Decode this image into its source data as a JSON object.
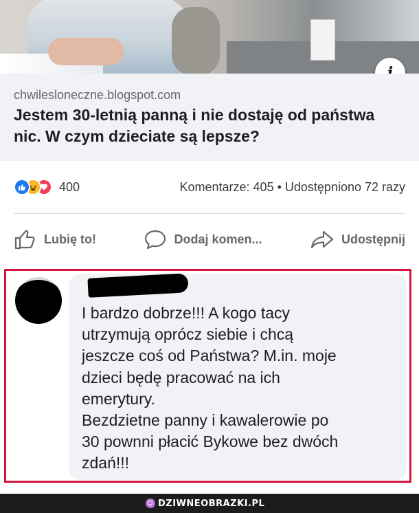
{
  "post": {
    "info_icon": "info-icon",
    "domain": "chwilesloneczne.blogspot.com",
    "headline": "Jestem 30-letnią panną i nie dostaję od państwa nic. W czym dzieciate są lepsze?"
  },
  "stats": {
    "reaction_icons": [
      "like-reaction-icon",
      "haha-reaction-icon",
      "love-reaction-icon"
    ],
    "reaction_count": "400",
    "summary": "Komentarze: 405 • Udostępniono 72 razy"
  },
  "actions": {
    "like_label": "Lubię to!",
    "comment_label": "Dodaj komen...",
    "share_label": "Udostępnij"
  },
  "comment": {
    "text": "I bardzo dobrze!!! A kogo tacy\nutrzymują oprócz siebie i chcą\njeszcze coś od Państwa? M.in. moje\ndzieci będę pracować na ich\nemerytury.\nBezdzietne panny i kawalerowie po\n30 pownni płacić Bykowe bez dwóch\nzdań!!!"
  },
  "colors": {
    "highlight_border": "#d0163a",
    "like_blue": "#1877f2",
    "love_red": "#f33e58",
    "haha_yellow": "#f7b928"
  },
  "watermark": {
    "text": "DZIWNEOBRAZKI.PL"
  }
}
